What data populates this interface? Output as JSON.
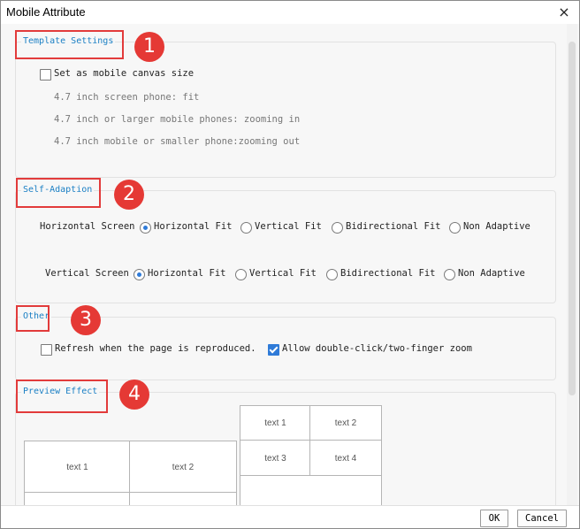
{
  "window": {
    "title": "Mobile Attribute",
    "close_icon": "×"
  },
  "sections": {
    "template": {
      "title": "Template Settings",
      "badge": "1",
      "checkbox_label": "Set as mobile canvas size",
      "notes": [
        "4.7 inch screen phone: fit",
        "4.7 inch or larger mobile phones: zooming in",
        "4.7 inch mobile or smaller phone:zooming out"
      ]
    },
    "adaption": {
      "title": "Self-Adaption",
      "badge": "2",
      "rows": [
        {
          "label": "Horizontal Screen",
          "options": [
            "Horizontal Fit",
            "Vertical Fit",
            "Bidirectional Fit",
            "Non Adaptive"
          ],
          "selected": "Horizontal Fit"
        },
        {
          "label": "Vertical Screen",
          "options": [
            "Horizontal Fit",
            "Vertical Fit",
            "Bidirectional Fit",
            "Non Adaptive"
          ],
          "selected": "Horizontal Fit"
        }
      ]
    },
    "other": {
      "title": "Other",
      "badge": "3",
      "refresh_label": "Refresh when the page is reproduced.",
      "refresh_checked": false,
      "zoom_label": "Allow double-click/two-finger zoom",
      "zoom_checked": true
    },
    "preview": {
      "title": "Preview Effect",
      "badge": "4",
      "left_cells": [
        "text 1",
        "text 2"
      ],
      "right_cells": [
        "text 1",
        "text 2",
        "text 3",
        "text 4"
      ]
    }
  },
  "footer": {
    "ok": "OK",
    "cancel": "Cancel"
  },
  "colors": {
    "accent": "#2f7bd8",
    "legend": "#1a7fc4",
    "highlight": "#e23b3b",
    "badge": "#e53935"
  }
}
